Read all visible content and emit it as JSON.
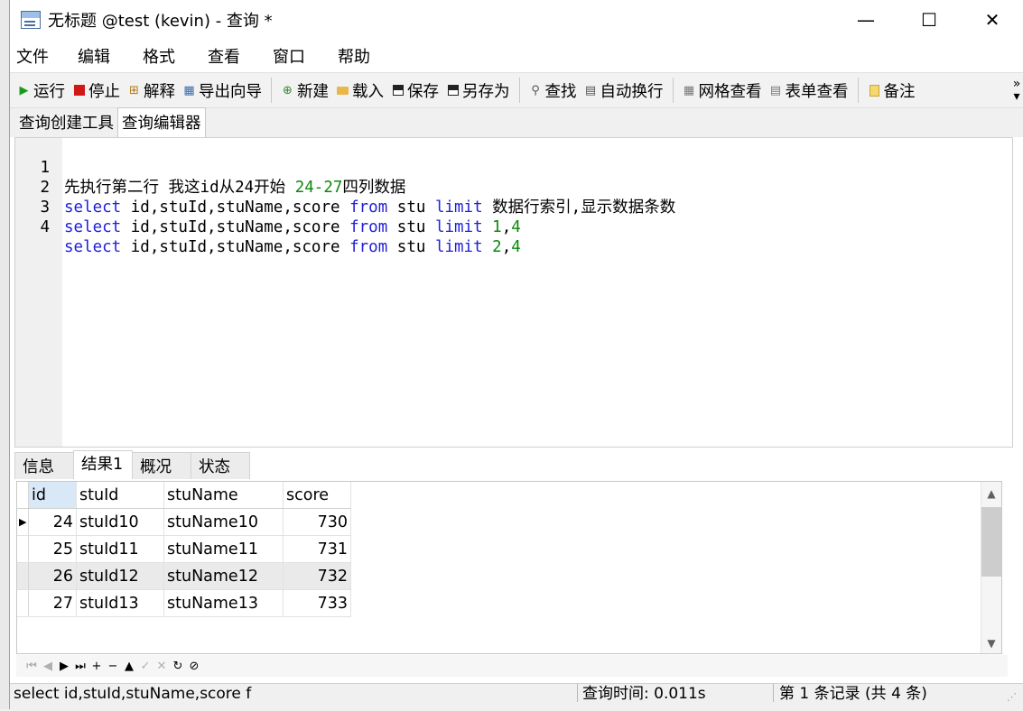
{
  "window": {
    "title": "无标题 @test (kevin) - 查询 *",
    "minimize_glyph": "—",
    "maximize_glyph": "☐",
    "close_glyph": "✕"
  },
  "menu": [
    "文件",
    "编辑",
    "格式",
    "查看",
    "窗口",
    "帮助"
  ],
  "toolbar": {
    "run": "运行",
    "stop": "停止",
    "explain": "解释",
    "export_wizard": "导出向导",
    "new": "新建",
    "load": "载入",
    "save": "保存",
    "save_as": "另存为",
    "find": "查找",
    "word_wrap": "自动换行",
    "grid_view": "网格查看",
    "form_view": "表单查看",
    "notes": "备注",
    "more": "»"
  },
  "doc_tabs": [
    "查询创建工具",
    "查询编辑器"
  ],
  "editor": {
    "lines": [
      {
        "n": "1",
        "comment": "先执行第二行 我这id从24开始 ",
        "num": "24-27",
        "tail": "四列数据"
      },
      {
        "n": "2",
        "kw1": "select",
        "cols": " id,stuId,stuName,score ",
        "kw2": "from",
        "tbl": " stu ",
        "kw3": "limit",
        "rest": " 数据行索引,显示数据条数"
      },
      {
        "n": "3",
        "kw1": "select",
        "cols": " id,stuId,stuName,score ",
        "kw2": "from",
        "tbl": " stu ",
        "kw3": "limit",
        "rest": " ",
        "n1": "1",
        "comma": ",",
        "n2": "4"
      },
      {
        "n": "4",
        "kw1": "select",
        "cols": " id,stuId,stuName,score ",
        "kw2": "from",
        "tbl": " stu ",
        "kw3": "limit",
        "rest": " ",
        "n1": "2",
        "comma": ",",
        "n2": "4"
      }
    ]
  },
  "result_tabs": [
    "信息",
    "结果1",
    "概况",
    "状态"
  ],
  "results": {
    "columns": [
      "id",
      "stuId",
      "stuName",
      "score"
    ],
    "rows": [
      [
        "24",
        "stuId10",
        "stuName10",
        "730"
      ],
      [
        "25",
        "stuId11",
        "stuName11",
        "731"
      ],
      [
        "26",
        "stuId12",
        "stuName12",
        "732"
      ],
      [
        "27",
        "stuId13",
        "stuName13",
        "733"
      ]
    ],
    "current_row_marker": "▶"
  },
  "navigator": [
    "⏮",
    "◀",
    "▶",
    "⏭",
    "+",
    "−",
    "▲",
    "✓",
    "✕",
    "↻",
    "⊘"
  ],
  "status": {
    "sql": "select id,stuId,stuName,score f",
    "query_time": "查询时间: 0.011s",
    "record": "第 1 条记录 (共 4 条)"
  }
}
